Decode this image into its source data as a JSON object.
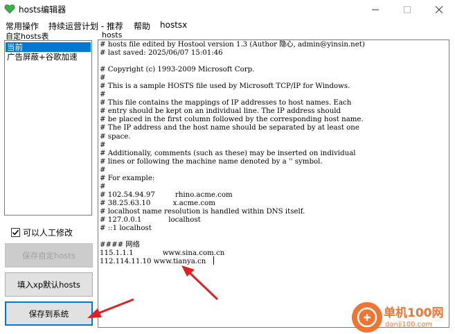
{
  "window": {
    "title": "hosts编辑器"
  },
  "menu": [
    "常用操作",
    "持续运营计划 - 推荐",
    "帮助",
    "hostsx"
  ],
  "left_panel": {
    "label": "自定hosts表",
    "items": [
      {
        "label": "当前",
        "selected": true
      },
      {
        "label": "广告屏蔽+谷歌加速",
        "selected": false
      }
    ],
    "checkbox": {
      "label": "可以人工修改",
      "checked": true
    },
    "buttons": {
      "save_custom": "保存自定hosts",
      "fill_xp": "填入xp默认hosts",
      "save_system": "保存到系统"
    }
  },
  "right_panel": {
    "label": "hosts",
    "lines": [
      "# hosts file edited by Hostool version 1.3 (Author 隐心, admin@yinsin.net)",
      "# last saved: 2025/06/07 15:01:46",
      "",
      "# Copyright (c) 1993-2009 Microsoft Corp.",
      "#",
      "# This is a sample HOSTS file used by Microsoft TCP/IP for Windows.",
      "#",
      "# This file contains the mappings of IP addresses to host names. Each",
      "# entry should be kept on an individual line. The IP address should",
      "# be placed in the first column followed by the corresponding host name.",
      "# The IP address and the host name should be separated by at least one",
      "# space.",
      "#",
      "# Additionally, comments (such as these) may be inserted on individual",
      "# lines or following the machine name denoted by a '' symbol.",
      "#",
      "# For example:",
      "#",
      "# 102.54.94.97         rhino.acme.com",
      "# 38.25.63.10          x.acme.com",
      "# localhost name resolution is handled within DNS itself.",
      "# 127.0.0.1            localhost",
      "# ::1 localhost",
      "",
      "#### 网络",
      "115.1.1.1             www.sina.com.cn",
      "112.114.11.10 www.tianya.cn"
    ]
  },
  "watermark": {
    "brand": "单机100网",
    "url": "danji100.com"
  },
  "colors": {
    "selection": "#0078d7",
    "arrow": "#e02020",
    "watermark": "#f06a21"
  }
}
